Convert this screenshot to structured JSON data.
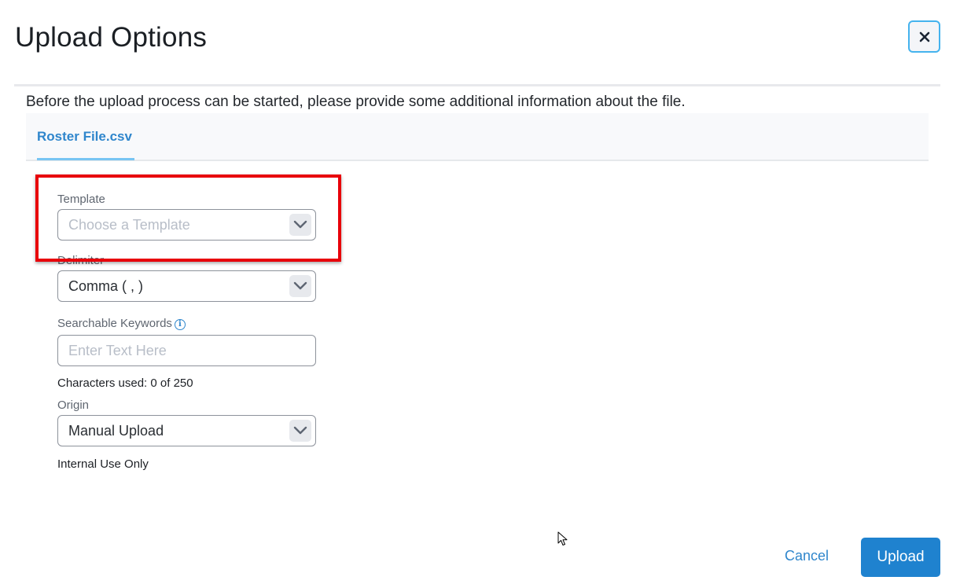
{
  "dialog": {
    "title": "Upload Options",
    "close_icon": "close-icon",
    "intro_text": "Before the upload process can be started, please provide some additional information about the file."
  },
  "tabs": [
    {
      "label": "Roster File.csv",
      "active": true
    }
  ],
  "form": {
    "template": {
      "label": "Template",
      "placeholder": "Choose a Template",
      "value": ""
    },
    "delimiter": {
      "label": "Delimiter",
      "value": "Comma ( , )"
    },
    "keywords": {
      "label": "Searchable Keywords",
      "info_icon": "info-icon",
      "placeholder": "Enter Text Here",
      "value": "",
      "counter": "Characters used: 0 of 250"
    },
    "origin": {
      "label": "Origin",
      "value": "Manual Upload",
      "note": "Internal Use Only"
    }
  },
  "footer": {
    "cancel_label": "Cancel",
    "upload_label": "Upload"
  },
  "colors": {
    "accent": "#1f82cf",
    "link": "#2f86cc",
    "highlight": "#e8000a",
    "focus_border": "#45b3ee"
  }
}
